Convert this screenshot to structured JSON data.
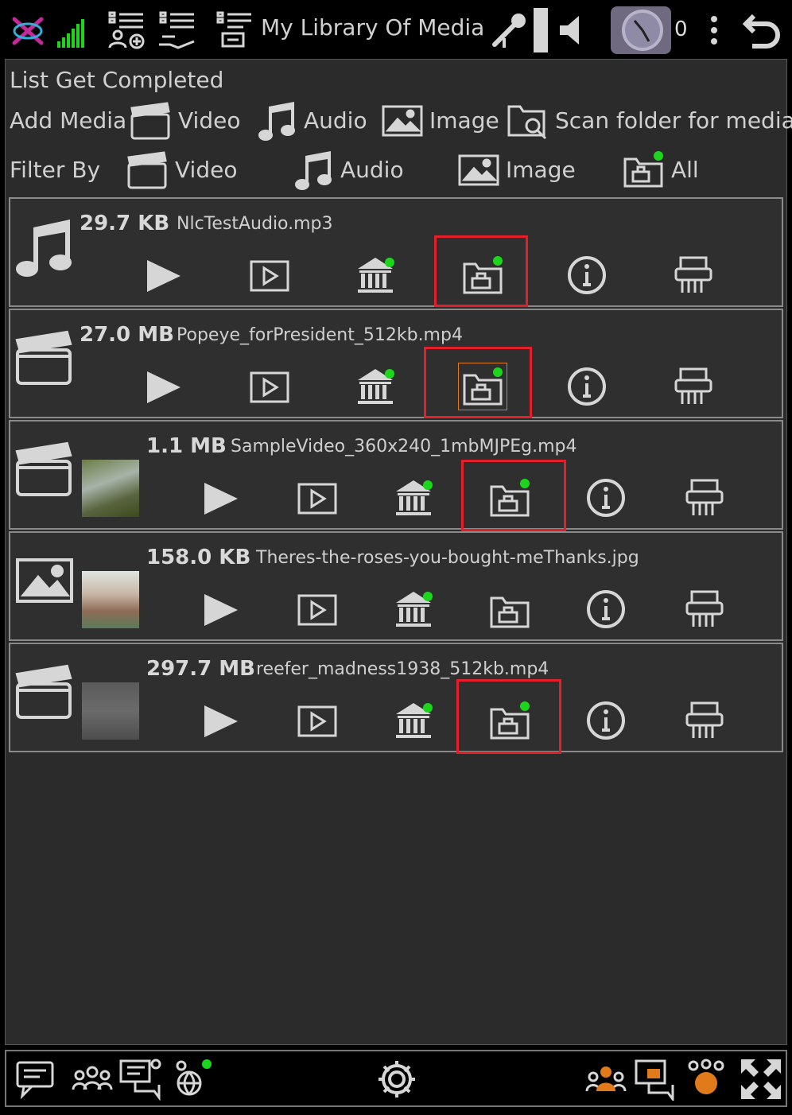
{
  "app": {
    "title": "My Library Of Media",
    "counter": "0"
  },
  "status": {
    "text": "List Get Completed"
  },
  "add_media": {
    "label": "Add Media",
    "video": "Video",
    "audio": "Audio",
    "image": "Image",
    "scan": "Scan folder for media"
  },
  "filter": {
    "label": "Filter By",
    "video": "Video",
    "audio": "Audio",
    "image": "Image",
    "all": "All"
  },
  "items": [
    {
      "size": "29.7 KB",
      "name": "NlcTestAudio.mp3",
      "type": "audio"
    },
    {
      "size": "27.0 MB",
      "name": "Popeye_forPresident_512kb.mp4",
      "type": "video"
    },
    {
      "size": "1.1 MB",
      "name": "SampleVideo_360x240_1mbMJPEg.mp4",
      "type": "video"
    },
    {
      "size": "158.0 KB",
      "name": "Theres-the-roses-you-bought-meThanks.jpg",
      "type": "image"
    },
    {
      "size": "297.7 MB",
      "name": "reefer_madness1938_512kb.mp4",
      "type": "video"
    }
  ],
  "colors": {
    "highlight": "#e3202a",
    "online": "#1ed51e",
    "accent": "#e07a1a"
  }
}
